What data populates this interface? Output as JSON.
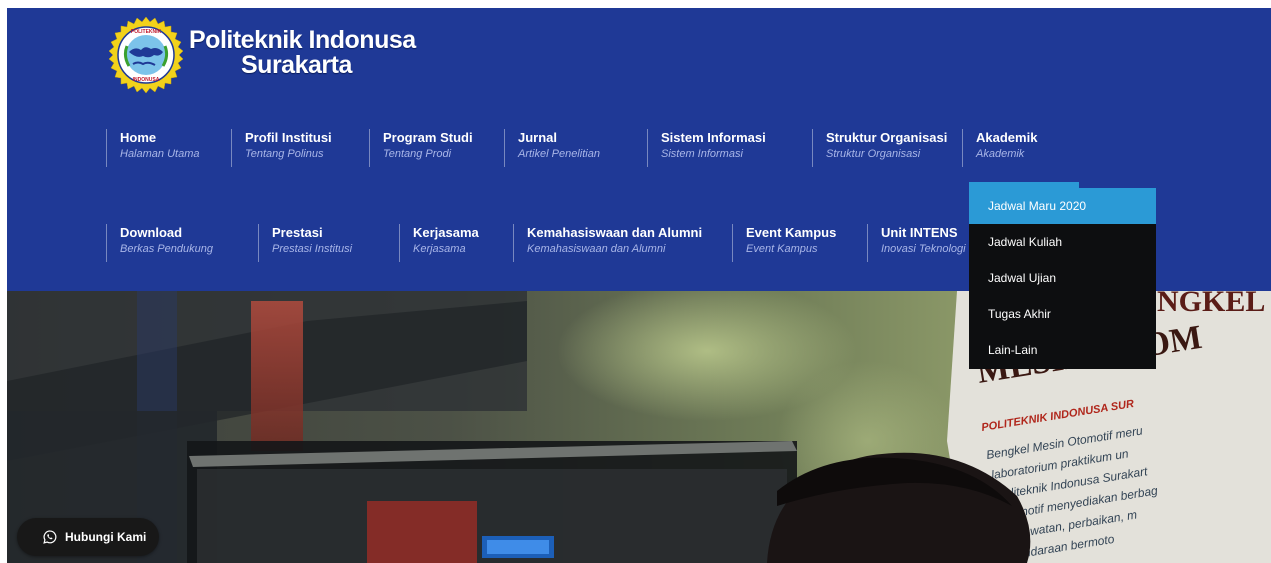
{
  "brand": {
    "line1": "Politeknik Indonusa",
    "line2": "Surakarta",
    "logo_icon": "college-seal-logo",
    "logo_text_top": "POLITEKNIK",
    "logo_text_bottom": "INDONUSA"
  },
  "nav_row1": [
    {
      "title": "Home",
      "subtitle": "Halaman Utama"
    },
    {
      "title": "Profil Institusi",
      "subtitle": "Tentang Polinus"
    },
    {
      "title": "Program Studi",
      "subtitle": "Tentang Prodi"
    },
    {
      "title": "Jurnal",
      "subtitle": "Artikel Penelitian"
    },
    {
      "title": "Sistem Informasi",
      "subtitle": "Sistem Informasi"
    },
    {
      "title": "Struktur Organisasi",
      "subtitle": "Struktur Organisasi"
    },
    {
      "title": "Akademik",
      "subtitle": "Akademik"
    }
  ],
  "nav_row2": [
    {
      "title": "Download",
      "subtitle": "Berkas Pendukung"
    },
    {
      "title": "Prestasi",
      "subtitle": "Prestasi Institusi"
    },
    {
      "title": "Kerjasama",
      "subtitle": "Kerjasama"
    },
    {
      "title": "Kemahasiswaan dan Alumni",
      "subtitle": "Kemahasiswaan dan Alumni"
    },
    {
      "title": "Event Kampus",
      "subtitle": "Event Kampus"
    },
    {
      "title": "Unit INTENS",
      "subtitle": "Inovasi Teknologi"
    }
  ],
  "dropdown": {
    "parent": "Akademik",
    "items": [
      "Jadwal Maru 2020",
      "Jadwal Kuliah",
      "Jadwal Ujian",
      "Tugas Akhir",
      "Lain-Lain"
    ],
    "active_index": 0
  },
  "hero": {
    "banner_lines": [
      "BENGKEL",
      "MESIN OTOM",
      "POLITEKNIK INDONUSA SUR"
    ],
    "banner_body": [
      "Bengkel Mesin Otomotif meru",
      "laboratorium praktikum un",
      "Politeknik Indonusa Surakart",
      "otomotif menyediakan berbag",
      "perawatan, perbaikan, m",
      "kendaraan bermoto"
    ]
  },
  "contact": {
    "label": "Hubungi Kami",
    "icon": "whatsapp-icon"
  },
  "colors": {
    "header_bg": "#1f3996",
    "accent": "#2b9ad6",
    "dropdown_bg": "#0d0e10",
    "subtitle": "#a9b6e8"
  }
}
